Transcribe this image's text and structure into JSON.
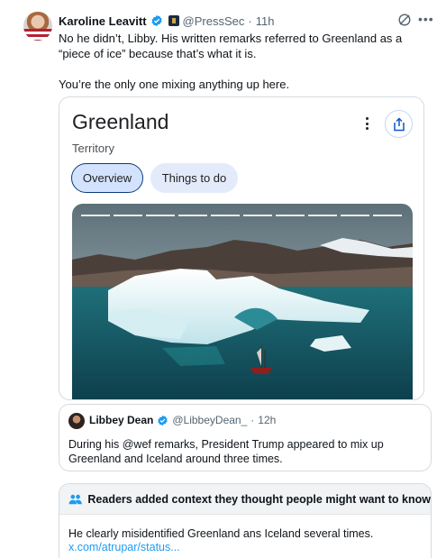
{
  "post": {
    "author_name": "Karoline Leavitt",
    "handle": "@PressSec",
    "separator": "·",
    "time": "11h",
    "text_line1": "No he didn’t, Libby. His written remarks referred to Greenland as a “piece of ice” because that’s what it is.",
    "text_line2": "You’re the only one mixing anything up here.",
    "icons": [
      "verified-badge-icon",
      "government-badge-icon",
      "grok-icon",
      "more-icon"
    ]
  },
  "card": {
    "title": "Greenland",
    "subtitle": "Territory",
    "tabs": [
      {
        "label": "Overview",
        "active": true
      },
      {
        "label": "Things to do",
        "active": false
      }
    ],
    "icons": [
      "kebab-menu-icon",
      "share-icon"
    ],
    "image_alt": "iceberg and sailboat in Greenland waters"
  },
  "quote": {
    "author_name": "Libbey Dean",
    "handle": "@LibbeyDean_",
    "separator": "·",
    "time": "12h",
    "text": "During his @wef remarks, President Trump appeared to mix up Greenland and Iceland around three times."
  },
  "community_note": {
    "header": "Readers added context they thought people might want to know",
    "text": "He clearly misidentified Greenland ans Iceland several times.",
    "link": "x.com/atrupar/status..."
  },
  "colors": {
    "verified_blue": "#1d9bf0",
    "text_primary": "#0f1419",
    "text_secondary": "#536471",
    "link_blue": "#1d9bf0",
    "chip_active_bg": "#d3e3fd"
  }
}
